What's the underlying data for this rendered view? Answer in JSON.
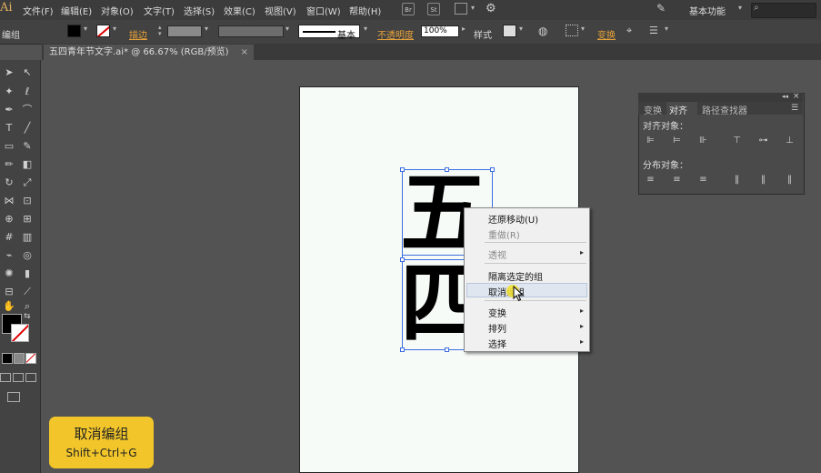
{
  "app": {
    "logo": "Ai",
    "workspace": "基本功能"
  },
  "menu": [
    "文件(F)",
    "编辑(E)",
    "对象(O)",
    "文字(T)",
    "选择(S)",
    "效果(C)",
    "视图(V)",
    "窗口(W)",
    "帮助(H)"
  ],
  "menubar_buttons": [
    "Br",
    "St"
  ],
  "control": {
    "mode_label": "编组",
    "stroke_label": "描边",
    "stroke_style": "基本",
    "opacity_label": "不透明度",
    "opacity_value": "100%",
    "style_label": "样式",
    "transform_label": "变换"
  },
  "document": {
    "tab_title": "五四青年节文字.ai* @ 66.67% (RGB/预览)"
  },
  "glyphs": [
    "五",
    "四"
  ],
  "context_menu": {
    "items": [
      {
        "label": "还原移动(U)",
        "enabled": true,
        "submenu": false
      },
      {
        "label": "重做(R)",
        "enabled": false,
        "submenu": false
      },
      {
        "label": "透视",
        "enabled": false,
        "submenu": true
      },
      {
        "label": "隔离选定的组",
        "enabled": true,
        "submenu": false
      },
      {
        "label": "取消编组",
        "enabled": true,
        "submenu": false,
        "highlighted": true
      },
      {
        "label": "变换",
        "enabled": true,
        "submenu": true
      },
      {
        "label": "排列",
        "enabled": true,
        "submenu": true
      },
      {
        "label": "选择",
        "enabled": true,
        "submenu": true
      }
    ]
  },
  "panel": {
    "tabs": [
      "变换",
      "对齐",
      "路径查找器"
    ],
    "active_tab": "对齐",
    "align_objects_label": "对齐对象：",
    "distribute_objects_label": "分布对象："
  },
  "shortcut_badge": {
    "title": "取消编组",
    "keys": "Shift+Ctrl+G"
  },
  "colors": {
    "badge": "#f2c62a",
    "accent": "#e8a23a",
    "selection": "#3d6ee0"
  }
}
